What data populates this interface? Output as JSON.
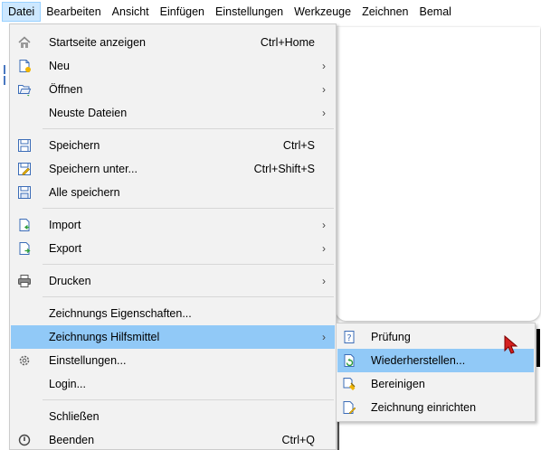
{
  "menubar": {
    "items": [
      "Datei",
      "Bearbeiten",
      "Ansicht",
      "Einfügen",
      "Einstellungen",
      "Werkzeuge",
      "Zeichnen",
      "Bemal"
    ]
  },
  "file_menu": {
    "items": [
      {
        "label": "Startseite anzeigen",
        "shortcut": "Ctrl+Home",
        "icon": "home-icon"
      },
      {
        "label": "Neu",
        "icon": "new-file-icon",
        "submenu": true
      },
      {
        "label": "Öffnen",
        "icon": "open-folder-icon",
        "submenu": true
      },
      {
        "label": "Neuste Dateien",
        "submenu": true
      },
      {
        "label": "Speichern",
        "shortcut": "Ctrl+S",
        "icon": "save-icon"
      },
      {
        "label": "Speichern unter...",
        "shortcut": "Ctrl+Shift+S",
        "icon": "save-as-icon"
      },
      {
        "label": "Alle speichern",
        "icon": "save-all-icon"
      },
      {
        "label": "Import",
        "icon": "import-icon",
        "submenu": true
      },
      {
        "label": "Export",
        "icon": "export-icon",
        "submenu": true
      },
      {
        "label": "Drucken",
        "icon": "printer-icon",
        "submenu": true
      },
      {
        "label": "Zeichnungs Eigenschaften..."
      },
      {
        "label": "Zeichnungs Hilfsmittel",
        "submenu": true,
        "highlighted": true
      },
      {
        "label": "Einstellungen...",
        "icon": "gear-icon"
      },
      {
        "label": "Login..."
      },
      {
        "label": "Schließen"
      },
      {
        "label": "Beenden",
        "shortcut": "Ctrl+Q",
        "icon": "power-icon"
      }
    ],
    "submenu_arrow": "›"
  },
  "tools_submenu": {
    "items": [
      {
        "label": "Prüfung",
        "icon": "audit-icon"
      },
      {
        "label": "Wiederherstellen...",
        "icon": "recover-icon",
        "highlighted": true
      },
      {
        "label": "Bereinigen",
        "icon": "purge-icon"
      },
      {
        "label": "Zeichnung einrichten",
        "icon": "drawing-setup-icon"
      }
    ]
  },
  "colors": {
    "highlight": "#91c9f7",
    "menu_background": "#f2f2f2",
    "menubar_active": "#cde8ff",
    "cursor": "#d42020"
  }
}
